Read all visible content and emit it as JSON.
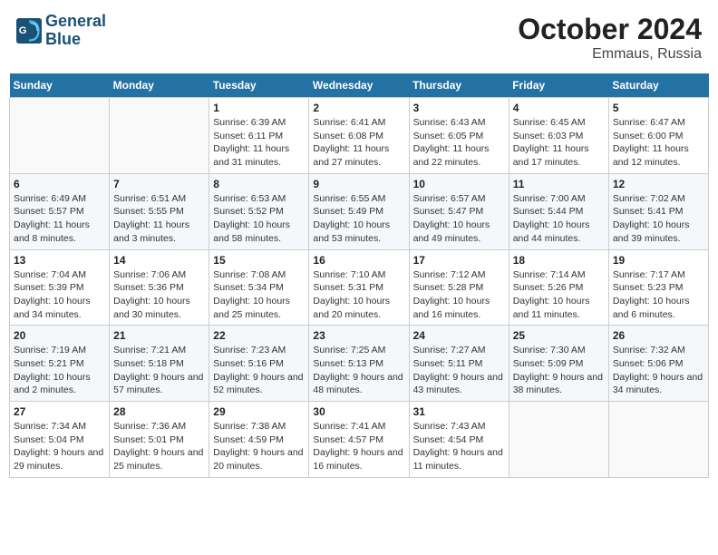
{
  "header": {
    "logo_line1": "General",
    "logo_line2": "Blue",
    "month": "October 2024",
    "location": "Emmaus, Russia"
  },
  "days_of_week": [
    "Sunday",
    "Monday",
    "Tuesday",
    "Wednesday",
    "Thursday",
    "Friday",
    "Saturday"
  ],
  "weeks": [
    [
      {
        "day": "",
        "info": ""
      },
      {
        "day": "",
        "info": ""
      },
      {
        "day": "1",
        "info": "Sunrise: 6:39 AM\nSunset: 6:11 PM\nDaylight: 11 hours and 31 minutes."
      },
      {
        "day": "2",
        "info": "Sunrise: 6:41 AM\nSunset: 6:08 PM\nDaylight: 11 hours and 27 minutes."
      },
      {
        "day": "3",
        "info": "Sunrise: 6:43 AM\nSunset: 6:05 PM\nDaylight: 11 hours and 22 minutes."
      },
      {
        "day": "4",
        "info": "Sunrise: 6:45 AM\nSunset: 6:03 PM\nDaylight: 11 hours and 17 minutes."
      },
      {
        "day": "5",
        "info": "Sunrise: 6:47 AM\nSunset: 6:00 PM\nDaylight: 11 hours and 12 minutes."
      }
    ],
    [
      {
        "day": "6",
        "info": "Sunrise: 6:49 AM\nSunset: 5:57 PM\nDaylight: 11 hours and 8 minutes."
      },
      {
        "day": "7",
        "info": "Sunrise: 6:51 AM\nSunset: 5:55 PM\nDaylight: 11 hours and 3 minutes."
      },
      {
        "day": "8",
        "info": "Sunrise: 6:53 AM\nSunset: 5:52 PM\nDaylight: 10 hours and 58 minutes."
      },
      {
        "day": "9",
        "info": "Sunrise: 6:55 AM\nSunset: 5:49 PM\nDaylight: 10 hours and 53 minutes."
      },
      {
        "day": "10",
        "info": "Sunrise: 6:57 AM\nSunset: 5:47 PM\nDaylight: 10 hours and 49 minutes."
      },
      {
        "day": "11",
        "info": "Sunrise: 7:00 AM\nSunset: 5:44 PM\nDaylight: 10 hours and 44 minutes."
      },
      {
        "day": "12",
        "info": "Sunrise: 7:02 AM\nSunset: 5:41 PM\nDaylight: 10 hours and 39 minutes."
      }
    ],
    [
      {
        "day": "13",
        "info": "Sunrise: 7:04 AM\nSunset: 5:39 PM\nDaylight: 10 hours and 34 minutes."
      },
      {
        "day": "14",
        "info": "Sunrise: 7:06 AM\nSunset: 5:36 PM\nDaylight: 10 hours and 30 minutes."
      },
      {
        "day": "15",
        "info": "Sunrise: 7:08 AM\nSunset: 5:34 PM\nDaylight: 10 hours and 25 minutes."
      },
      {
        "day": "16",
        "info": "Sunrise: 7:10 AM\nSunset: 5:31 PM\nDaylight: 10 hours and 20 minutes."
      },
      {
        "day": "17",
        "info": "Sunrise: 7:12 AM\nSunset: 5:28 PM\nDaylight: 10 hours and 16 minutes."
      },
      {
        "day": "18",
        "info": "Sunrise: 7:14 AM\nSunset: 5:26 PM\nDaylight: 10 hours and 11 minutes."
      },
      {
        "day": "19",
        "info": "Sunrise: 7:17 AM\nSunset: 5:23 PM\nDaylight: 10 hours and 6 minutes."
      }
    ],
    [
      {
        "day": "20",
        "info": "Sunrise: 7:19 AM\nSunset: 5:21 PM\nDaylight: 10 hours and 2 minutes."
      },
      {
        "day": "21",
        "info": "Sunrise: 7:21 AM\nSunset: 5:18 PM\nDaylight: 9 hours and 57 minutes."
      },
      {
        "day": "22",
        "info": "Sunrise: 7:23 AM\nSunset: 5:16 PM\nDaylight: 9 hours and 52 minutes."
      },
      {
        "day": "23",
        "info": "Sunrise: 7:25 AM\nSunset: 5:13 PM\nDaylight: 9 hours and 48 minutes."
      },
      {
        "day": "24",
        "info": "Sunrise: 7:27 AM\nSunset: 5:11 PM\nDaylight: 9 hours and 43 minutes."
      },
      {
        "day": "25",
        "info": "Sunrise: 7:30 AM\nSunset: 5:09 PM\nDaylight: 9 hours and 38 minutes."
      },
      {
        "day": "26",
        "info": "Sunrise: 7:32 AM\nSunset: 5:06 PM\nDaylight: 9 hours and 34 minutes."
      }
    ],
    [
      {
        "day": "27",
        "info": "Sunrise: 7:34 AM\nSunset: 5:04 PM\nDaylight: 9 hours and 29 minutes."
      },
      {
        "day": "28",
        "info": "Sunrise: 7:36 AM\nSunset: 5:01 PM\nDaylight: 9 hours and 25 minutes."
      },
      {
        "day": "29",
        "info": "Sunrise: 7:38 AM\nSunset: 4:59 PM\nDaylight: 9 hours and 20 minutes."
      },
      {
        "day": "30",
        "info": "Sunrise: 7:41 AM\nSunset: 4:57 PM\nDaylight: 9 hours and 16 minutes."
      },
      {
        "day": "31",
        "info": "Sunrise: 7:43 AM\nSunset: 4:54 PM\nDaylight: 9 hours and 11 minutes."
      },
      {
        "day": "",
        "info": ""
      },
      {
        "day": "",
        "info": ""
      }
    ]
  ]
}
